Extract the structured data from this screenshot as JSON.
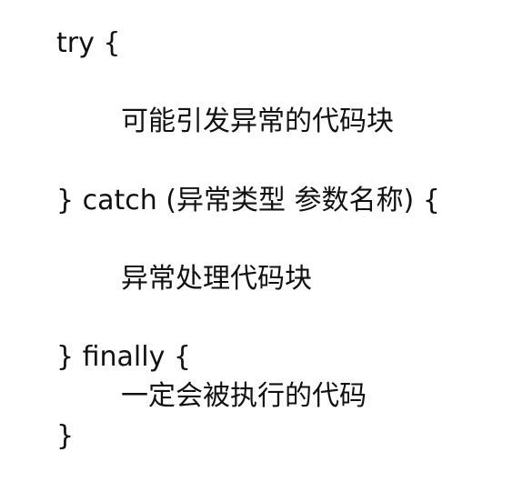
{
  "code": {
    "lines": [
      "try {",
      "可能引发异常的代码块",
      "} catch (异常类型 参数名称)  {",
      "异常处理代码块",
      "} finally {",
      "一定会被执行的代码",
      "}"
    ]
  }
}
